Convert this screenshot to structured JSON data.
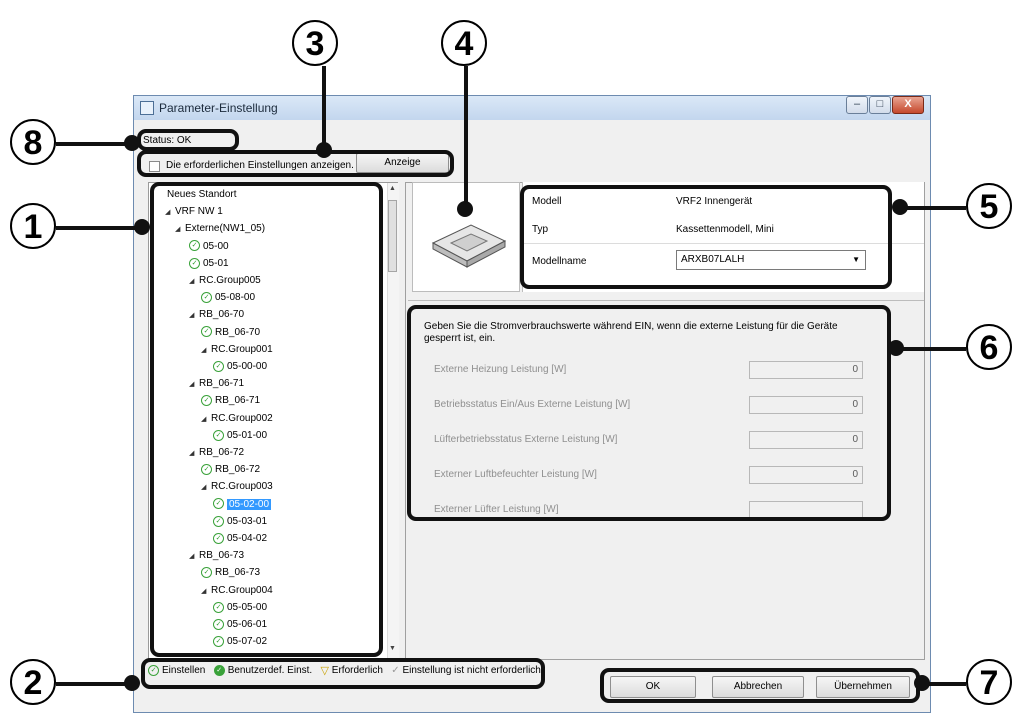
{
  "window": {
    "title": "Parameter-Einstellung",
    "min_label": "–",
    "max_label": "□",
    "close_label": "X"
  },
  "status": "Status: OK",
  "options": {
    "checkbox_label": "Die erforderlichen Einstellungen anzeigen.",
    "display_button": "Anzeige"
  },
  "tree": [
    {
      "label": "Neues Standort",
      "level": 0,
      "type": "root"
    },
    {
      "label": "VRF NW 1",
      "level": 1,
      "type": "node"
    },
    {
      "label": "Externe(NW1_05)",
      "level": 2,
      "type": "node"
    },
    {
      "label": "05-00",
      "level": 3,
      "type": "check"
    },
    {
      "label": "05-01",
      "level": 3,
      "type": "check"
    },
    {
      "label": "RC.Group005",
      "level": 3,
      "type": "node"
    },
    {
      "label": "05-08-00",
      "level": 4,
      "type": "check"
    },
    {
      "label": "RB_06-70",
      "level": 3,
      "type": "node"
    },
    {
      "label": "RB_06-70",
      "level": 4,
      "type": "check"
    },
    {
      "label": "RC.Group001",
      "level": 4,
      "type": "node"
    },
    {
      "label": "05-00-00",
      "level": 5,
      "type": "check"
    },
    {
      "label": "RB_06-71",
      "level": 3,
      "type": "node"
    },
    {
      "label": "RB_06-71",
      "level": 4,
      "type": "check"
    },
    {
      "label": "RC.Group002",
      "level": 4,
      "type": "node"
    },
    {
      "label": "05-01-00",
      "level": 5,
      "type": "check"
    },
    {
      "label": "RB_06-72",
      "level": 3,
      "type": "node"
    },
    {
      "label": "RB_06-72",
      "level": 4,
      "type": "check"
    },
    {
      "label": "RC.Group003",
      "level": 4,
      "type": "node"
    },
    {
      "label": "05-02-00",
      "level": 5,
      "type": "check",
      "selected": true
    },
    {
      "label": "05-03-01",
      "level": 5,
      "type": "check"
    },
    {
      "label": "05-04-02",
      "level": 5,
      "type": "check"
    },
    {
      "label": "RB_06-73",
      "level": 3,
      "type": "node"
    },
    {
      "label": "RB_06-73",
      "level": 4,
      "type": "check"
    },
    {
      "label": "RC.Group004",
      "level": 4,
      "type": "node"
    },
    {
      "label": "05-05-00",
      "level": 5,
      "type": "check"
    },
    {
      "label": "05-06-01",
      "level": 5,
      "type": "check"
    },
    {
      "label": "05-07-02",
      "level": 5,
      "type": "check"
    }
  ],
  "model_info": {
    "model_label": "Modell",
    "model_value": "VRF2 Innengerät",
    "type_label": "Typ",
    "type_value": "Kassettenmodell, Mini",
    "modelname_label": "Modellname",
    "modelname_value": "ARXB07LALH"
  },
  "power": {
    "description": "Geben Sie die Stromverbrauchswerte während EIN, wenn die externe Leistung für die Geräte gesperrt ist, ein.",
    "fields": [
      {
        "label": "Externe Heizung Leistung [W]",
        "value": "0"
      },
      {
        "label": "Betriebsstatus Ein/Aus Externe Leistung [W]",
        "value": "0"
      },
      {
        "label": "Lüfterbetriebsstatus Externe Leistung [W]",
        "value": "0"
      },
      {
        "label": "Externer Luftbefeuchter Leistung [W]",
        "value": "0"
      },
      {
        "label": "Externer Lüfter Leistung [W]",
        "value": ""
      }
    ]
  },
  "legend": {
    "set": "Einstellen",
    "user_defined": "Benutzerdef. Einst.",
    "required": "Erforderlich",
    "not_required": "Einstellung ist nicht erforderlich"
  },
  "buttons": {
    "ok": "OK",
    "cancel": "Abbrechen",
    "apply": "Übernehmen"
  },
  "callouts": [
    "8",
    "3",
    "4",
    "1",
    "5",
    "6",
    "2",
    "7"
  ]
}
